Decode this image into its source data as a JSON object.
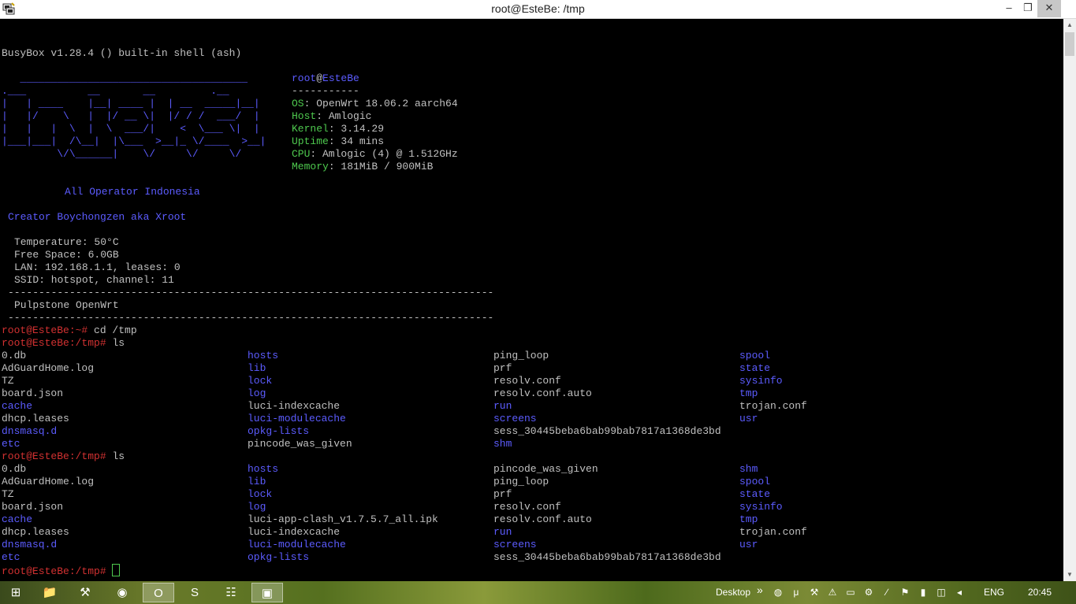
{
  "window": {
    "title": "root@EsteBe: /tmp",
    "minimize_glyph": "–",
    "maximize_glyph": "❐",
    "close_glyph": "✕"
  },
  "terminal": {
    "busybox": "BusyBox v1.28.4 () built-in shell (ash)",
    "logo": [
      "   _____________________________________",
      ".___          __       __         .__",
      "|   | ____    |__| ____ |  | __  _____|__|",
      "|   |/    \\   |  |/ __ \\|  |/ / /  ___/  |",
      "|   |   |  \\  |  \\  ___/|    <  \\___ \\|  |",
      "|___|___|  /\\__|  |\\___  >__|_ \\/____  >__|",
      "         \\/\\______|    \\/     \\/     \\/"
    ],
    "sysinfo": {
      "user": "root",
      "at": "@",
      "host": "EsteBe",
      "divider": "-----------",
      "rows": [
        {
          "label": "OS",
          "value": ": OpenWrt 18.06.2 aarch64"
        },
        {
          "label": "Host",
          "value": ": Amlogic"
        },
        {
          "label": "Kernel",
          "value": ": 3.14.29"
        },
        {
          "label": "Uptime",
          "value": ": 34 mins"
        },
        {
          "label": "CPU",
          "value": ": Amlogic (4) @ 1.512GHz"
        },
        {
          "label": "Memory",
          "value": ": 181MiB / 900MiB"
        }
      ]
    },
    "tagline": "All Operator Indonesia",
    "creator": "Creator Boychongzen aka Xroot",
    "stats": [
      "Temperature: 50°C",
      "Free Space: 6.0GB",
      "LAN: 192.168.1.1, leases: 0",
      "SSID: hotspot, channel: 11"
    ],
    "rule": "-------------------------------------------------------------------------------",
    "banner": "Pulpstone OpenWrt",
    "prompts": [
      {
        "prompt": "root@EsteBe:~# ",
        "command": "cd /tmp"
      },
      {
        "prompt": "root@EsteBe:/tmp# ",
        "command": "ls"
      },
      {
        "prompt": "root@EsteBe:/tmp# ",
        "command": "ls"
      },
      {
        "prompt": "root@EsteBe:/tmp# ",
        "command": ""
      }
    ],
    "listing1": [
      [
        {
          "t": "0.db",
          "d": false
        },
        {
          "t": "hosts",
          "d": true
        },
        {
          "t": "ping_loop",
          "d": false
        },
        {
          "t": "spool",
          "d": true
        }
      ],
      [
        {
          "t": "AdGuardHome.log",
          "d": false
        },
        {
          "t": "lib",
          "d": true
        },
        {
          "t": "prf",
          "d": false
        },
        {
          "t": "state",
          "d": true
        }
      ],
      [
        {
          "t": "TZ",
          "d": false
        },
        {
          "t": "lock",
          "d": true
        },
        {
          "t": "resolv.conf",
          "d": false
        },
        {
          "t": "sysinfo",
          "d": true
        }
      ],
      [
        {
          "t": "board.json",
          "d": false
        },
        {
          "t": "log",
          "d": true
        },
        {
          "t": "resolv.conf.auto",
          "d": false
        },
        {
          "t": "tmp",
          "d": true
        }
      ],
      [
        {
          "t": "cache",
          "d": true
        },
        {
          "t": "luci-indexcache",
          "d": false
        },
        {
          "t": "run",
          "d": true
        },
        {
          "t": "trojan.conf",
          "d": false
        }
      ],
      [
        {
          "t": "dhcp.leases",
          "d": false
        },
        {
          "t": "luci-modulecache",
          "d": true
        },
        {
          "t": "screens",
          "d": true
        },
        {
          "t": "usr",
          "d": true
        }
      ],
      [
        {
          "t": "dnsmasq.d",
          "d": true
        },
        {
          "t": "opkg-lists",
          "d": true
        },
        {
          "t": "sess_30445beba6bab99bab7817a1368de3bd",
          "d": false
        },
        {
          "t": "",
          "d": false
        }
      ],
      [
        {
          "t": "etc",
          "d": true
        },
        {
          "t": "pincode_was_given",
          "d": false
        },
        {
          "t": "shm",
          "d": true
        },
        {
          "t": "",
          "d": false
        }
      ]
    ],
    "listing2": [
      [
        {
          "t": "0.db",
          "d": false
        },
        {
          "t": "hosts",
          "d": true
        },
        {
          "t": "pincode_was_given",
          "d": false
        },
        {
          "t": "shm",
          "d": true
        }
      ],
      [
        {
          "t": "AdGuardHome.log",
          "d": false
        },
        {
          "t": "lib",
          "d": true
        },
        {
          "t": "ping_loop",
          "d": false
        },
        {
          "t": "spool",
          "d": true
        }
      ],
      [
        {
          "t": "TZ",
          "d": false
        },
        {
          "t": "lock",
          "d": true
        },
        {
          "t": "prf",
          "d": false
        },
        {
          "t": "state",
          "d": true
        }
      ],
      [
        {
          "t": "board.json",
          "d": false
        },
        {
          "t": "log",
          "d": true
        },
        {
          "t": "resolv.conf",
          "d": false
        },
        {
          "t": "sysinfo",
          "d": true
        }
      ],
      [
        {
          "t": "cache",
          "d": true
        },
        {
          "t": "luci-app-clash_v1.7.5.7_all.ipk",
          "d": false
        },
        {
          "t": "resolv.conf.auto",
          "d": false
        },
        {
          "t": "tmp",
          "d": true
        }
      ],
      [
        {
          "t": "dhcp.leases",
          "d": false
        },
        {
          "t": "luci-indexcache",
          "d": false
        },
        {
          "t": "run",
          "d": true
        },
        {
          "t": "trojan.conf",
          "d": false
        }
      ],
      [
        {
          "t": "dnsmasq.d",
          "d": true
        },
        {
          "t": "luci-modulecache",
          "d": true
        },
        {
          "t": "screens",
          "d": true
        },
        {
          "t": "usr",
          "d": true
        }
      ],
      [
        {
          "t": "etc",
          "d": true
        },
        {
          "t": "opkg-lists",
          "d": true
        },
        {
          "t": "sess_30445beba6bab99bab7817a1368de3bd",
          "d": false
        },
        {
          "t": "",
          "d": false
        }
      ]
    ]
  },
  "taskbar": {
    "apps": [
      {
        "name": "start-button",
        "icon": "windows-logo-icon",
        "glyph": "⊞",
        "active": false
      },
      {
        "name": "file-explorer",
        "icon": "folder-icon",
        "glyph": "📁",
        "active": false
      },
      {
        "name": "app-tool",
        "icon": "tool-icon",
        "glyph": "⚒",
        "active": false
      },
      {
        "name": "chrome",
        "icon": "chrome-icon",
        "glyph": "◉",
        "active": false
      },
      {
        "name": "opera",
        "icon": "opera-icon",
        "glyph": "O",
        "active": true
      },
      {
        "name": "sublime-text",
        "icon": "sublime-icon",
        "glyph": "S",
        "active": false
      },
      {
        "name": "network-tool",
        "icon": "network-icon",
        "glyph": "☷",
        "active": false
      },
      {
        "name": "putty",
        "icon": "putty-icon",
        "glyph": "▣",
        "active": true
      }
    ],
    "desktop_label": "Desktop",
    "chevron": "»",
    "language": "ENG",
    "time": "20:45",
    "tray_icons": [
      {
        "name": "globe-icon",
        "glyph": "◍"
      },
      {
        "name": "utorrent-icon",
        "glyph": "μ"
      },
      {
        "name": "tool-tray-icon",
        "glyph": "⚒"
      },
      {
        "name": "warning-icon",
        "glyph": "⚠"
      },
      {
        "name": "monitor-icon",
        "glyph": "▭"
      },
      {
        "name": "settings-icon",
        "glyph": "⚙"
      },
      {
        "name": "pen-icon",
        "glyph": "∕"
      },
      {
        "name": "flag-icon",
        "glyph": "⚑"
      },
      {
        "name": "power-icon",
        "glyph": "▮"
      },
      {
        "name": "network-tray-icon",
        "glyph": "◫"
      },
      {
        "name": "volume-icon",
        "glyph": "◂"
      }
    ]
  },
  "colors": {
    "prompt": "#d23131",
    "label": "#4ec94e",
    "directory": "#5c5cff",
    "text": "#c0c0c0"
  }
}
